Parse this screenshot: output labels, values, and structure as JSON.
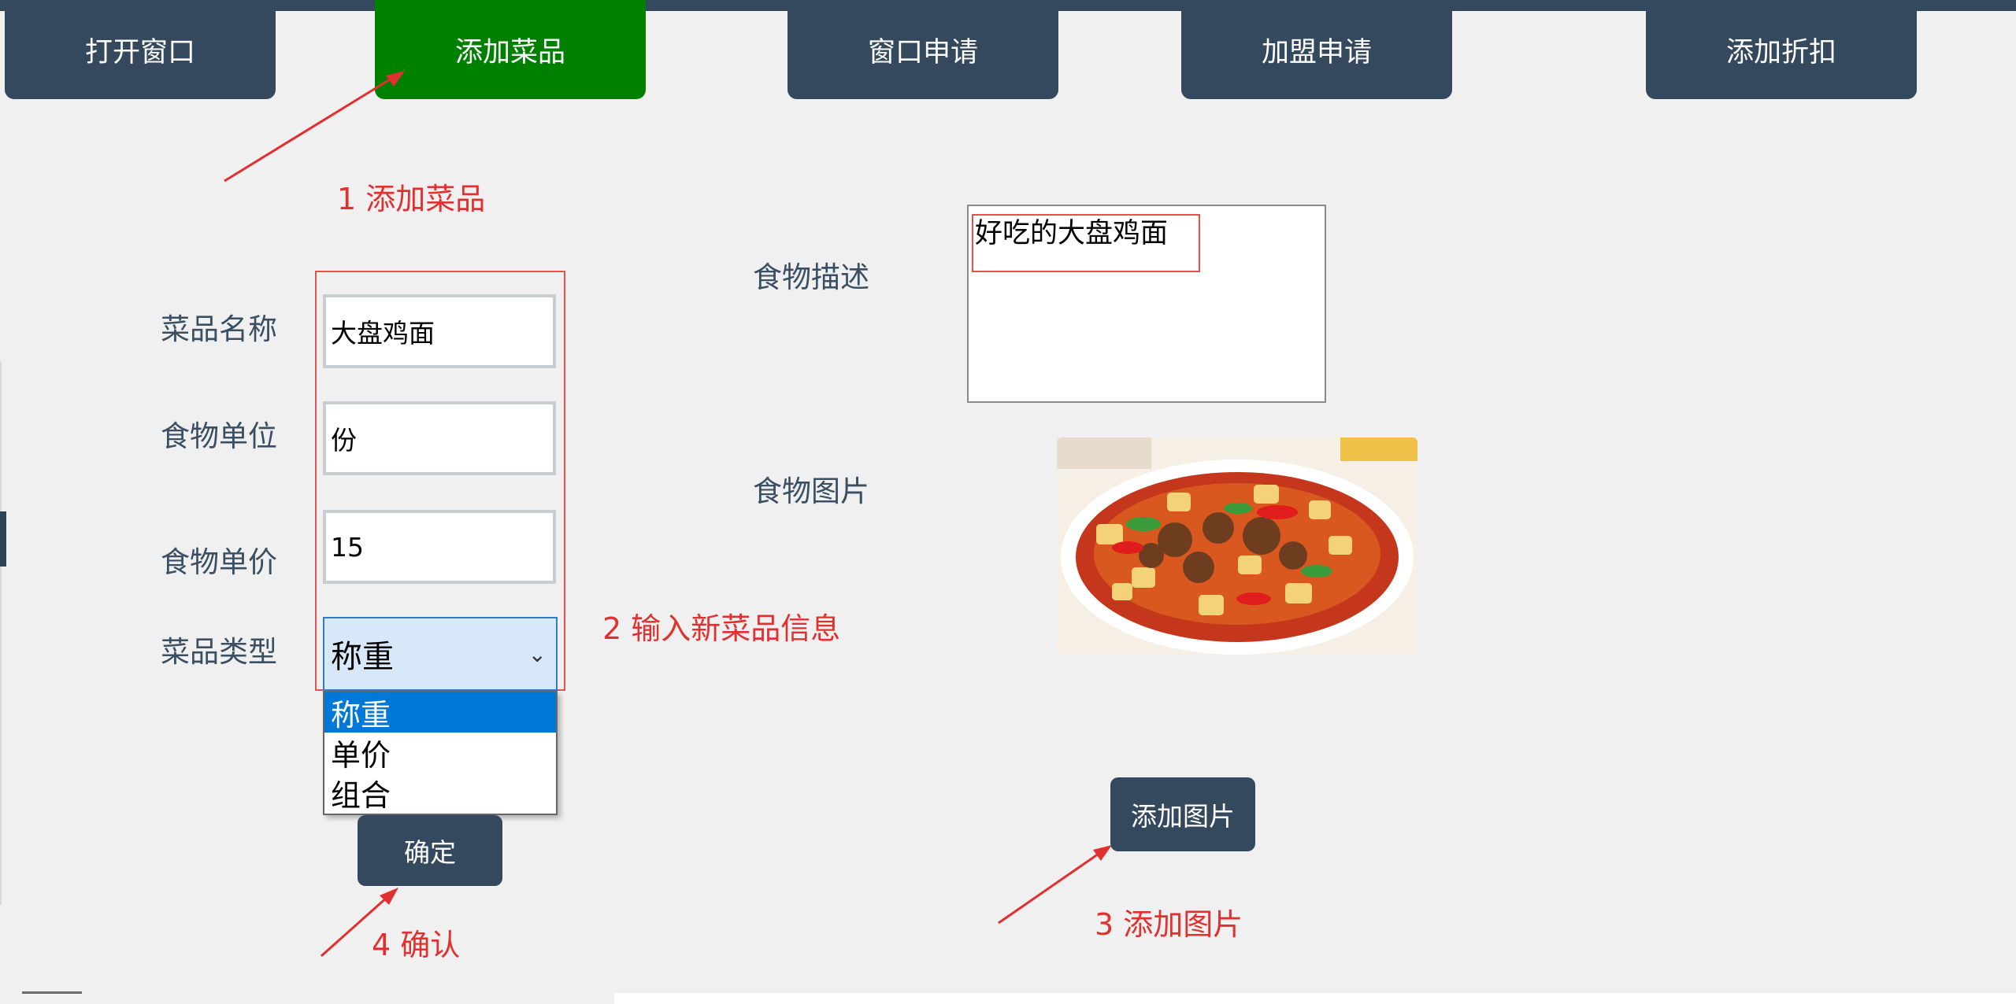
{
  "tabs": [
    {
      "label": "打开窗口"
    },
    {
      "label": "添加菜品"
    },
    {
      "label": "窗口申请"
    },
    {
      "label": "加盟申请"
    },
    {
      "label": "添加折扣"
    }
  ],
  "form": {
    "dish_name_label": "菜品名称",
    "dish_name_value": "大盘鸡面",
    "unit_label": "食物单位",
    "unit_value": "份",
    "price_label": "食物单价",
    "price_value": "15",
    "type_label": "菜品类型",
    "type_selected": "称重",
    "type_options": [
      "称重",
      "单价",
      "组合"
    ],
    "confirm_button": "确定"
  },
  "right": {
    "desc_label": "食物描述",
    "desc_value": "好吃的大盘鸡面",
    "image_label": "食物图片",
    "add_image_button": "添加图片"
  },
  "annotations": {
    "step1": "1 添加菜品",
    "step2": "2 输入新菜品信息",
    "step3": "3 添加图片",
    "step4": "4 确认"
  },
  "colors": {
    "tab_bg": "#34485e",
    "tab_active": "#008000",
    "annotation": "#e03030",
    "selection": "#0078d7"
  }
}
